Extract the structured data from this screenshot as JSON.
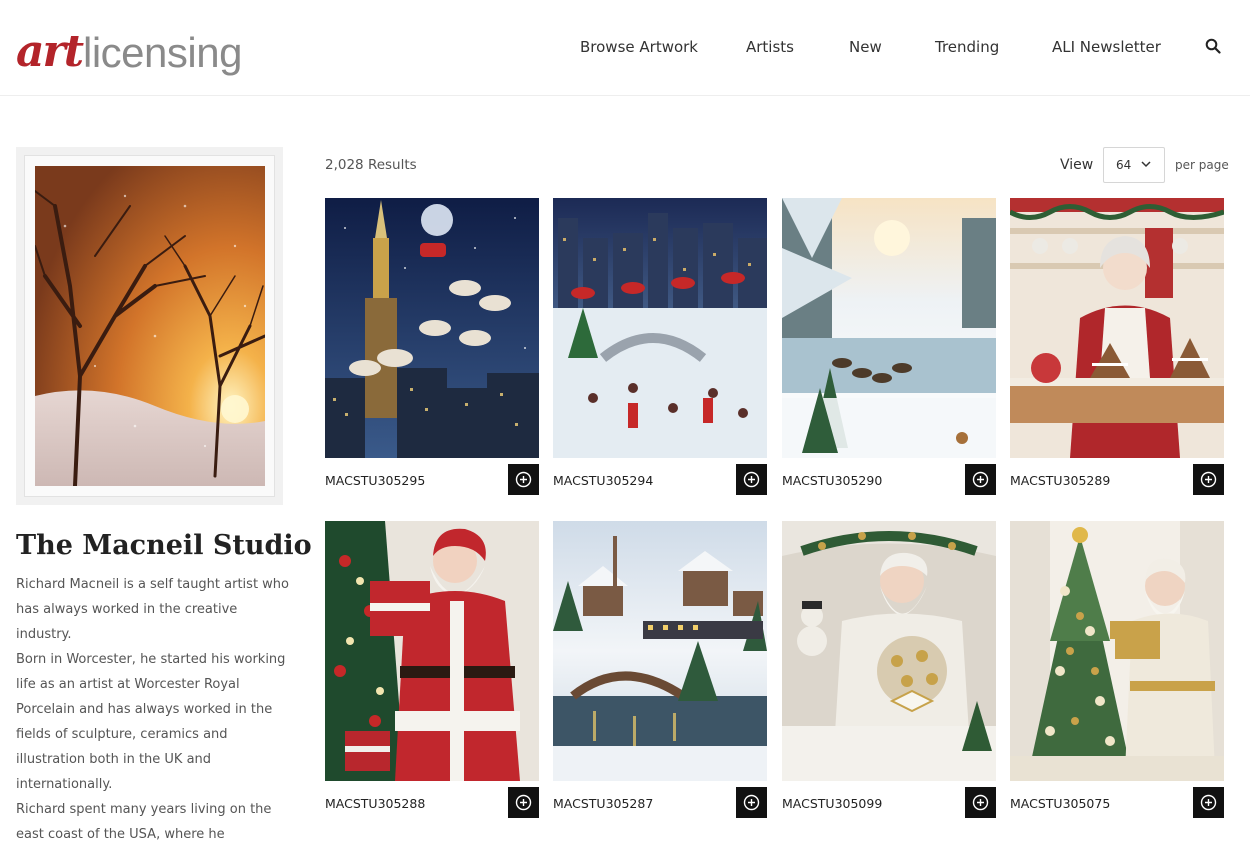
{
  "header": {
    "logo_part1": "art",
    "logo_part2": "licensing",
    "nav": [
      {
        "label": "Browse Artwork"
      },
      {
        "label": "Artists"
      },
      {
        "label": "New"
      },
      {
        "label": "Trending"
      },
      {
        "label": "ALI Newsletter"
      }
    ],
    "search_icon": "search-icon"
  },
  "sidebar": {
    "artist_name": "The Macneil Studio",
    "bio": [
      "Richard Macneil is a self taught artist who has always worked in the creative industry.",
      "Born in Worcester, he started his working life as an artist at Worcester Royal Porcelain and has always worked in the fields of sculpture, ceramics and illustration both in the UK and internationally.",
      "Richard spent many years living on the east coast of the USA, where he"
    ]
  },
  "results": {
    "count": "2,028 Results",
    "view_label": "View",
    "per_page_value": "64",
    "per_page_label": "per page"
  },
  "artworks": [
    {
      "code": "MACSTU305295"
    },
    {
      "code": "MACSTU305294"
    },
    {
      "code": "MACSTU305290"
    },
    {
      "code": "MACSTU305289"
    },
    {
      "code": "MACSTU305288"
    },
    {
      "code": "MACSTU305287"
    },
    {
      "code": "MACSTU305099"
    },
    {
      "code": "MACSTU305075"
    }
  ],
  "colors": {
    "brand_red": "#b3242a",
    "logo_gray": "#8a8a8a",
    "button_dark": "#111111"
  }
}
